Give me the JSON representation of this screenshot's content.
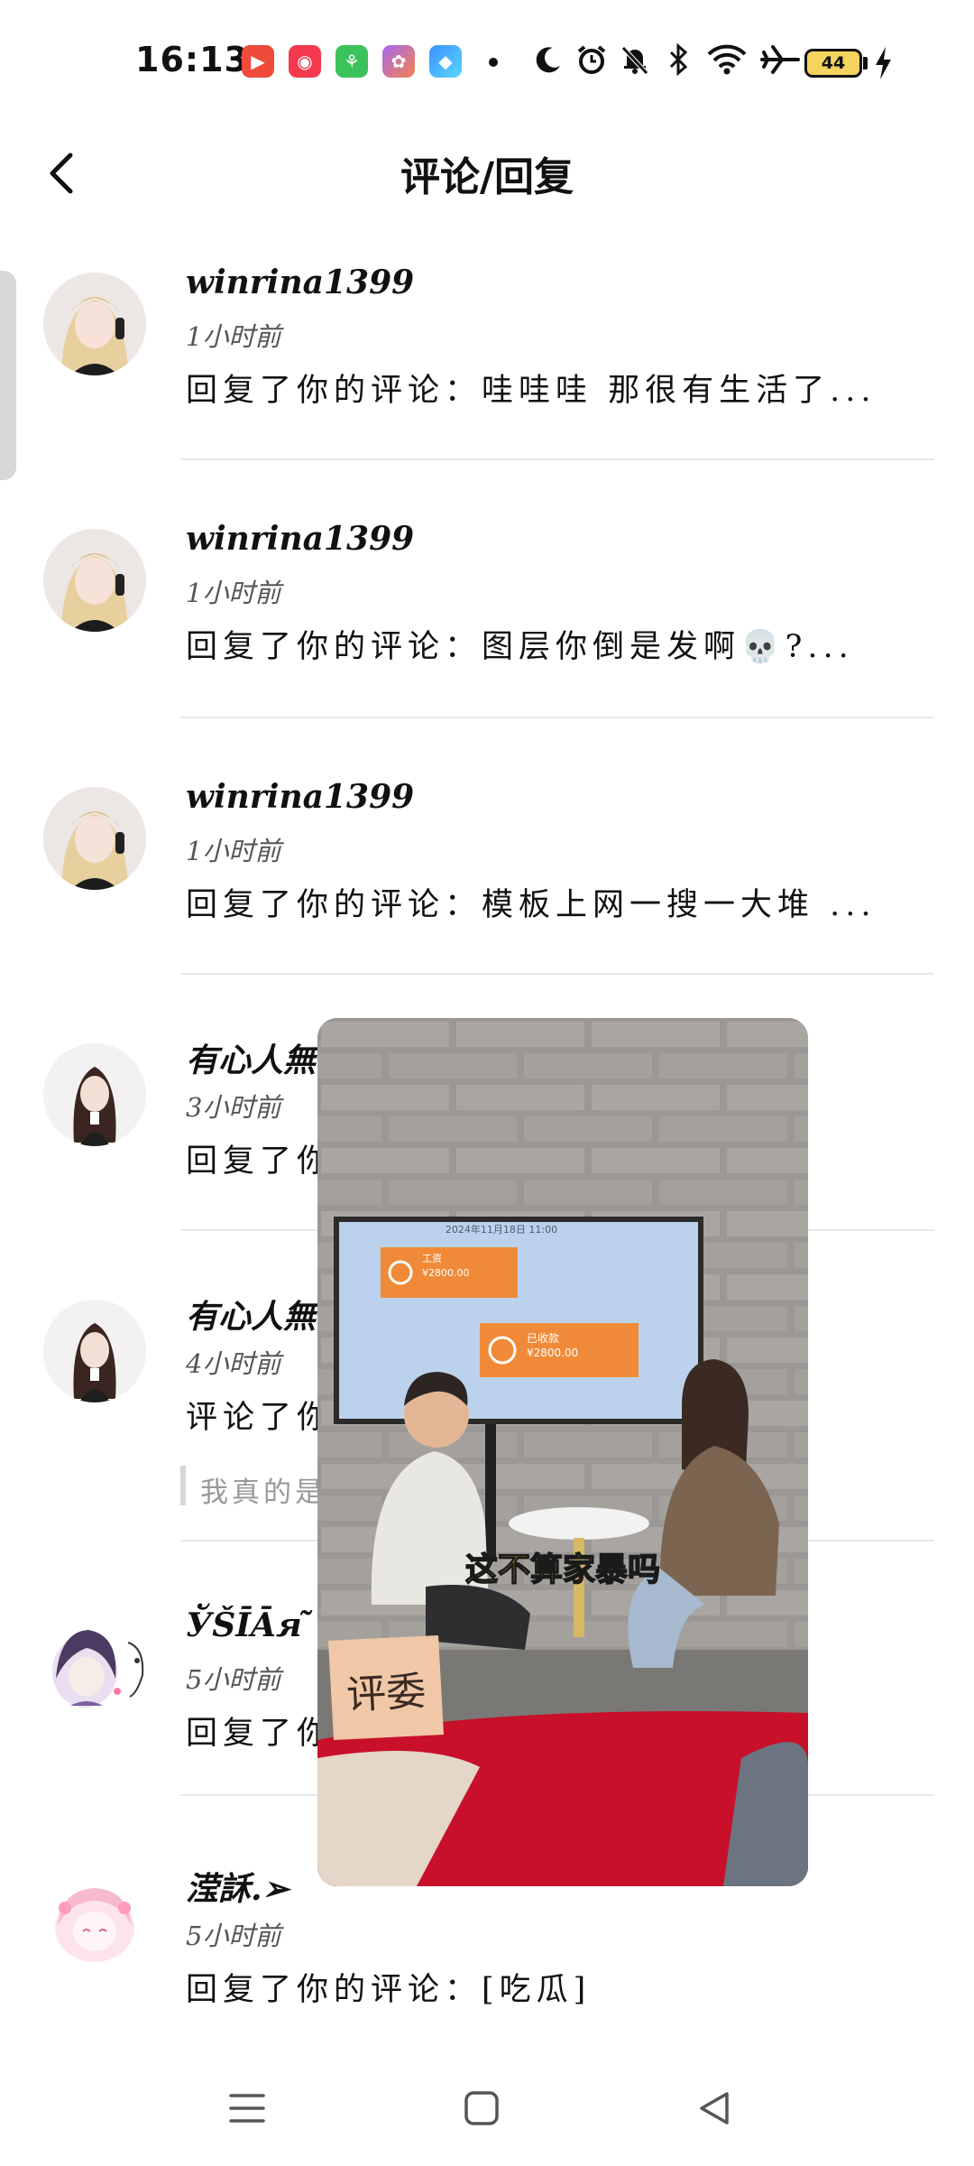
{
  "status_bar": {
    "time": "16:13",
    "battery": "44",
    "app_icons": [
      "video-app-icon",
      "camera-app-icon",
      "android-store-icon",
      "palette-app-icon",
      "blue-app-icon"
    ],
    "system_icons": [
      "moon-icon",
      "alarm-icon",
      "mute-bell-icon",
      "bluetooth-icon",
      "wifi-icon",
      "airplane-icon"
    ]
  },
  "header": {
    "title": "评论/回复"
  },
  "notifications": [
    {
      "user": "winrina1399",
      "time": "1小时前",
      "text": "回复了你的评论：哇哇哇 那很有生活了..."
    },
    {
      "user": "winrina1399",
      "time": "1小时前",
      "text": "回复了你的评论：图层你倒是发啊💀?..."
    },
    {
      "user": "winrina1399",
      "time": "1小时前",
      "text": "回复了你的评论：模板上网一搜一大堆 ..."
    },
    {
      "user": "有心人無",
      "time": "3小时前",
      "text": "回复了你"
    },
    {
      "user": "有心人無",
      "time": "4小时前",
      "text": "评论了你",
      "quote": "我真的是"
    },
    {
      "user": "ЎŠĪĀя ̃",
      "time": "5小时前",
      "text": "回复了你"
    },
    {
      "user": "滢訸.➢",
      "time": "5小时前",
      "text": "回复了你的评论：[吃瓜]"
    }
  ],
  "video_overlay": {
    "screen_top_text": "2024年11月18日 11:00",
    "card1_label": "工资",
    "card1_amount": "¥2800.00",
    "card2_label": "已收款",
    "card2_amount": "¥2800.00",
    "subtitle_part1": "这不算",
    "subtitle_part2": "家暴",
    "subtitle_part3": "吗",
    "sign_text": "评委"
  },
  "nav_bar": {
    "items": [
      "menu-icon",
      "home-icon",
      "back-triangle-icon"
    ]
  },
  "colors": {
    "accent_orange": "#f08a38",
    "battery": "#f4d35e",
    "subtitle_yellow": "#ffe227",
    "subtitle_orange": "#ff8a1e"
  }
}
